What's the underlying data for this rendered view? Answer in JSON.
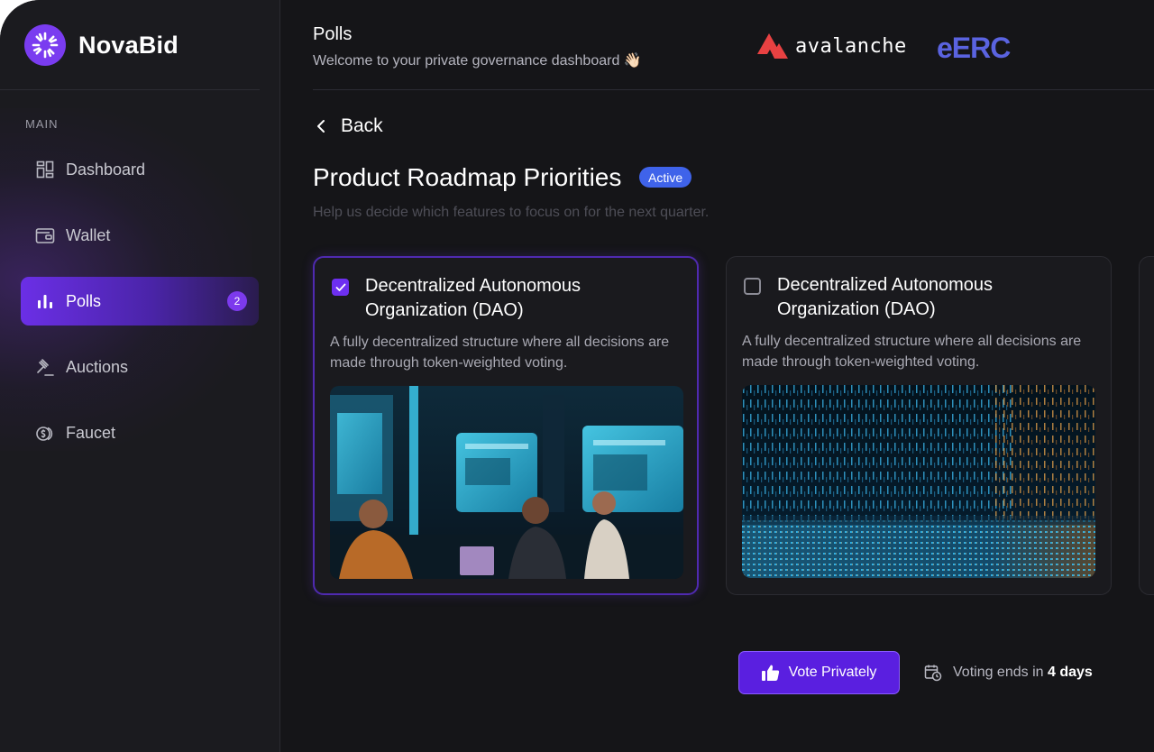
{
  "brand": {
    "name": "NovaBid",
    "accent": "#7a3cf0"
  },
  "sidebar": {
    "section_label": "MAIN",
    "items": [
      {
        "label": "Dashboard",
        "icon": "dashboard-icon"
      },
      {
        "label": "Wallet",
        "icon": "wallet-icon"
      },
      {
        "label": "Polls",
        "icon": "bar-chart-icon",
        "active": true,
        "badge": "2"
      },
      {
        "label": "Auctions",
        "icon": "gavel-icon"
      },
      {
        "label": "Faucet",
        "icon": "coins-icon"
      }
    ]
  },
  "header": {
    "title": "Polls",
    "subtitle": "Welcome to your private governance dashboard 👋🏻",
    "partners": {
      "avalanche": "avalanche",
      "eerc": "eERC"
    }
  },
  "poll": {
    "back_label": "Back",
    "title": "Product Roadmap Priorities",
    "status": "Active",
    "description": "Help us decide which features to focus on for the next quarter.",
    "options": [
      {
        "title": "Decentralized Autonomous Organization (DAO)",
        "description": "A fully decentralized structure where all decisions are made through token-weighted voting.",
        "checked": true,
        "image": "team-meeting-scifi-image"
      },
      {
        "title": "Decentralized Autonomous Organization (DAO)",
        "description": "A fully decentralized structure where all decisions are made through token-weighted voting.",
        "checked": false,
        "image": "data-rain-image"
      }
    ],
    "vote_button": "Vote Privately",
    "ends_prefix": "Voting ends in",
    "ends_value": "4 days"
  },
  "colors": {
    "status_badge": "#3f63ea",
    "vote_button": "#5a1fe0",
    "eerc": "#5a63e0",
    "avalanche_red": "#e84142"
  }
}
